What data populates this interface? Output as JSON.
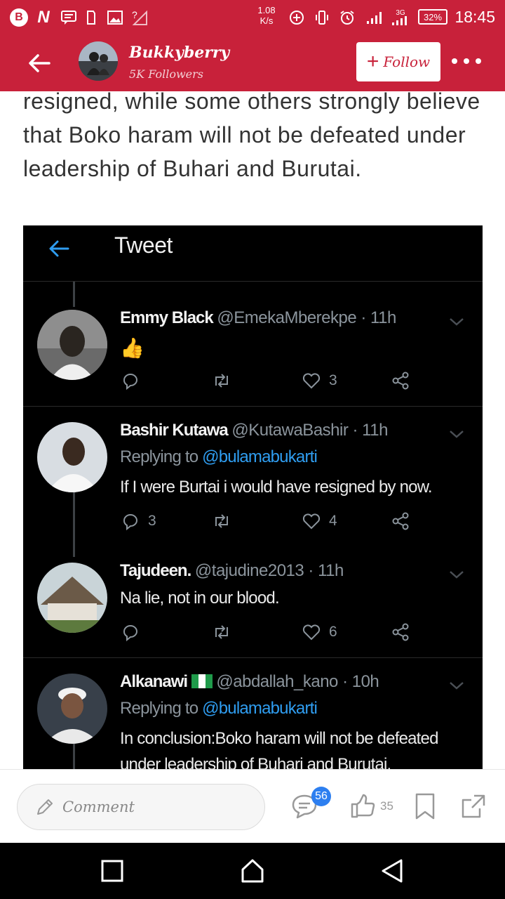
{
  "status_bar": {
    "net_speed_value": "1.08",
    "net_speed_unit": "K/s",
    "network_type": "3G",
    "battery": "32%",
    "time": "18:45"
  },
  "header": {
    "author_name": "Bukkyberry",
    "followers": "5K Followers",
    "follow_label": "Follow"
  },
  "article": {
    "text": "resigned, while some others strongly believe that Boko haram will not be defeated under leadership of Buhari and Burutai."
  },
  "tweet_screenshot": {
    "title": "Tweet",
    "tweets": [
      {
        "name": "Emmy Black",
        "handle": "@EmekaMberekpe · 11h",
        "replying_prefix": "",
        "mention": "",
        "text": "👍",
        "replies": "",
        "likes": "3"
      },
      {
        "name": "Bashir Kutawa",
        "handle": "@KutawaBashir · 11h",
        "replying_prefix": "Replying to",
        "mention": "@bulamabukarti",
        "text": "If I were Burtai i would have resigned by now.",
        "replies": "3",
        "likes": "4"
      },
      {
        "name": "Tajudeen.",
        "handle": "@tajudine2013 · 11h",
        "replying_prefix": "",
        "mention": "",
        "text": "Na lie, not in our blood.",
        "replies": "",
        "likes": "6"
      },
      {
        "name": "Alkanawi",
        "handle": "@abdallah_kano · 10h",
        "replying_prefix": "Replying to",
        "mention": "@bulamabukarti",
        "text": "In conclusion:Boko haram will not be defeated under leadership of Buhari and Burutai.",
        "replies": "",
        "likes": ""
      }
    ]
  },
  "bottom_bar": {
    "comment_placeholder": "Comment",
    "comment_count": "56",
    "like_count": "35"
  },
  "colors": {
    "brand_red": "#c8213a",
    "twitter_blue": "#2f9df0",
    "badge_blue": "#2d7ff0"
  }
}
